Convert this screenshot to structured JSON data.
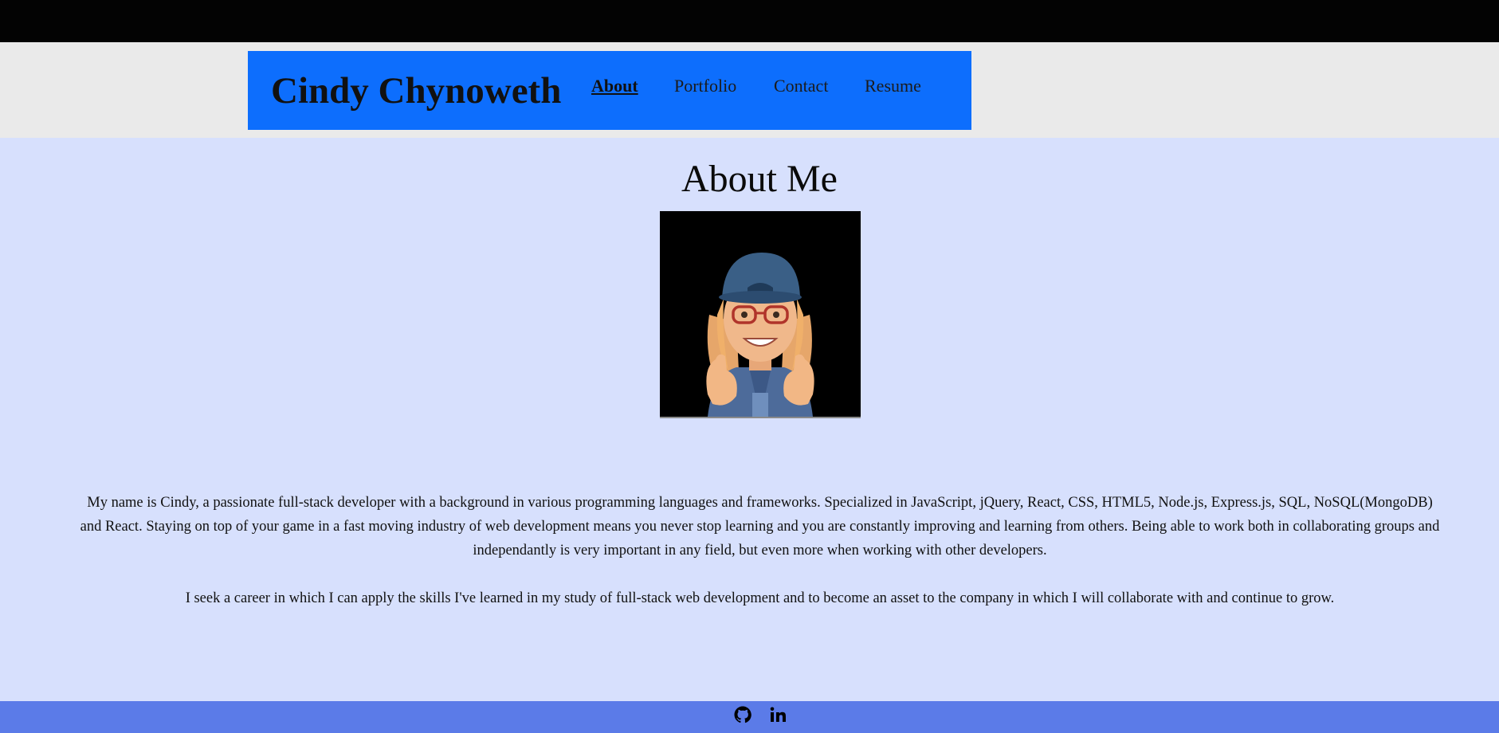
{
  "header": {
    "brand": "Cindy Chynoweth",
    "nav": [
      {
        "label": "About",
        "active": true
      },
      {
        "label": "Portfolio",
        "active": false
      },
      {
        "label": "Contact",
        "active": false
      },
      {
        "label": "Resume",
        "active": false
      }
    ]
  },
  "main": {
    "title": "About Me",
    "avatar": "avatar-portrait",
    "bio": "My name is Cindy, a passionate full-stack developer with a background in various programming languages and frameworks. Specialized in JavaScript, jQuery, React, CSS, HTML5, Node.js, Express.js, SQL, NoSQL(MongoDB) and React. Staying on top of your game in a fast moving industry of web development means you never stop learning and you are constantly improving and learning from others. Being able to work both in collaborating groups and independantly is very important in any field, but even more when working with other developers.",
    "goal": "I seek a career in which I can apply the skills I've learned in my study of full-stack web development and to become an asset to the company in which I will collaborate with and continue to grow."
  },
  "footer": {
    "icons": [
      "github-icon",
      "linkedin-icon"
    ]
  },
  "colors": {
    "topbar": "#030303",
    "header_band": "#eaeaea",
    "nav_background": "#0d6efd",
    "page_background": "#d7e0fd",
    "footer_background": "#5b7be8"
  }
}
